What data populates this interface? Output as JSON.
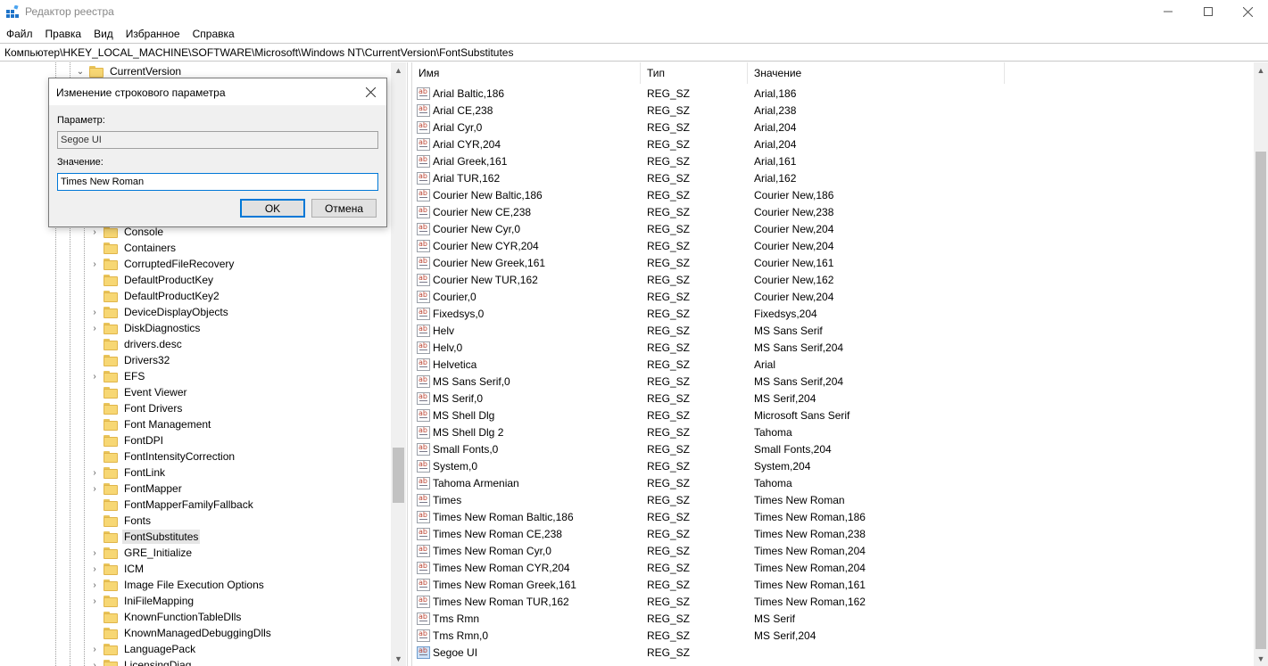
{
  "window": {
    "title": "Редактор реестра",
    "icon": "registry-editor-icon"
  },
  "menu": [
    "Файл",
    "Правка",
    "Вид",
    "Избранное",
    "Справка"
  ],
  "address": "Компьютер\\HKEY_LOCAL_MACHINE\\SOFTWARE\\Microsoft\\Windows NT\\CurrentVersion\\FontSubstitutes",
  "tree": {
    "parent": {
      "label": "CurrentVersion",
      "expanded": true
    },
    "items": [
      {
        "label": "Console",
        "expandable": true
      },
      {
        "label": "Containers",
        "expandable": false
      },
      {
        "label": "CorruptedFileRecovery",
        "expandable": true
      },
      {
        "label": "DefaultProductKey",
        "expandable": false
      },
      {
        "label": "DefaultProductKey2",
        "expandable": false
      },
      {
        "label": "DeviceDisplayObjects",
        "expandable": true
      },
      {
        "label": "DiskDiagnostics",
        "expandable": true
      },
      {
        "label": "drivers.desc",
        "expandable": false
      },
      {
        "label": "Drivers32",
        "expandable": false
      },
      {
        "label": "EFS",
        "expandable": true
      },
      {
        "label": "Event Viewer",
        "expandable": false
      },
      {
        "label": "Font Drivers",
        "expandable": false
      },
      {
        "label": "Font Management",
        "expandable": false
      },
      {
        "label": "FontDPI",
        "expandable": false
      },
      {
        "label": "FontIntensityCorrection",
        "expandable": false
      },
      {
        "label": "FontLink",
        "expandable": true
      },
      {
        "label": "FontMapper",
        "expandable": true
      },
      {
        "label": "FontMapperFamilyFallback",
        "expandable": false
      },
      {
        "label": "Fonts",
        "expandable": false
      },
      {
        "label": "FontSubstitutes",
        "expandable": false,
        "selected": true
      },
      {
        "label": "GRE_Initialize",
        "expandable": true
      },
      {
        "label": "ICM",
        "expandable": true
      },
      {
        "label": "Image File Execution Options",
        "expandable": true
      },
      {
        "label": "IniFileMapping",
        "expandable": true
      },
      {
        "label": "KnownFunctionTableDlls",
        "expandable": false
      },
      {
        "label": "KnownManagedDebuggingDlls",
        "expandable": false
      },
      {
        "label": "LanguagePack",
        "expandable": true
      },
      {
        "label": "LicensingDiag",
        "expandable": true
      }
    ]
  },
  "list": {
    "columns": [
      "Имя",
      "Тип",
      "Значение"
    ],
    "rows": [
      {
        "name": "Arial Baltic,186",
        "type": "REG_SZ",
        "value": "Arial,186"
      },
      {
        "name": "Arial CE,238",
        "type": "REG_SZ",
        "value": "Arial,238"
      },
      {
        "name": "Arial Cyr,0",
        "type": "REG_SZ",
        "value": "Arial,204"
      },
      {
        "name": "Arial CYR,204",
        "type": "REG_SZ",
        "value": "Arial,204"
      },
      {
        "name": "Arial Greek,161",
        "type": "REG_SZ",
        "value": "Arial,161"
      },
      {
        "name": "Arial TUR,162",
        "type": "REG_SZ",
        "value": "Arial,162"
      },
      {
        "name": "Courier New Baltic,186",
        "type": "REG_SZ",
        "value": "Courier New,186"
      },
      {
        "name": "Courier New CE,238",
        "type": "REG_SZ",
        "value": "Courier New,238"
      },
      {
        "name": "Courier New Cyr,0",
        "type": "REG_SZ",
        "value": "Courier New,204"
      },
      {
        "name": "Courier New CYR,204",
        "type": "REG_SZ",
        "value": "Courier New,204"
      },
      {
        "name": "Courier New Greek,161",
        "type": "REG_SZ",
        "value": "Courier New,161"
      },
      {
        "name": "Courier New TUR,162",
        "type": "REG_SZ",
        "value": "Courier New,162"
      },
      {
        "name": "Courier,0",
        "type": "REG_SZ",
        "value": "Courier New,204"
      },
      {
        "name": "Fixedsys,0",
        "type": "REG_SZ",
        "value": "Fixedsys,204"
      },
      {
        "name": "Helv",
        "type": "REG_SZ",
        "value": "MS Sans Serif"
      },
      {
        "name": "Helv,0",
        "type": "REG_SZ",
        "value": "MS Sans Serif,204"
      },
      {
        "name": "Helvetica",
        "type": "REG_SZ",
        "value": "Arial"
      },
      {
        "name": "MS Sans Serif,0",
        "type": "REG_SZ",
        "value": "MS Sans Serif,204"
      },
      {
        "name": "MS Serif,0",
        "type": "REG_SZ",
        "value": "MS Serif,204"
      },
      {
        "name": "MS Shell Dlg",
        "type": "REG_SZ",
        "value": "Microsoft Sans Serif"
      },
      {
        "name": "MS Shell Dlg 2",
        "type": "REG_SZ",
        "value": "Tahoma"
      },
      {
        "name": "Small Fonts,0",
        "type": "REG_SZ",
        "value": "Small Fonts,204"
      },
      {
        "name": "System,0",
        "type": "REG_SZ",
        "value": "System,204"
      },
      {
        "name": "Tahoma Armenian",
        "type": "REG_SZ",
        "value": "Tahoma"
      },
      {
        "name": "Times",
        "type": "REG_SZ",
        "value": "Times New Roman"
      },
      {
        "name": "Times New Roman Baltic,186",
        "type": "REG_SZ",
        "value": "Times New Roman,186"
      },
      {
        "name": "Times New Roman CE,238",
        "type": "REG_SZ",
        "value": "Times New Roman,238"
      },
      {
        "name": "Times New Roman Cyr,0",
        "type": "REG_SZ",
        "value": "Times New Roman,204"
      },
      {
        "name": "Times New Roman CYR,204",
        "type": "REG_SZ",
        "value": "Times New Roman,204"
      },
      {
        "name": "Times New Roman Greek,161",
        "type": "REG_SZ",
        "value": "Times New Roman,161"
      },
      {
        "name": "Times New Roman TUR,162",
        "type": "REG_SZ",
        "value": "Times New Roman,162"
      },
      {
        "name": "Tms Rmn",
        "type": "REG_SZ",
        "value": "MS Serif"
      },
      {
        "name": "Tms Rmn,0",
        "type": "REG_SZ",
        "value": "MS Serif,204"
      },
      {
        "name": "Segoe UI",
        "type": "REG_SZ",
        "value": "",
        "selected": true
      }
    ]
  },
  "dialog": {
    "title": "Изменение строкового параметра",
    "param_label": "Параметр:",
    "param_value": "Segoe UI",
    "value_label": "Значение:",
    "value_value": "Times New Roman",
    "ok_label": "OK",
    "cancel_label": "Отмена"
  },
  "colors": {
    "accent": "#0078d7",
    "folder": "#f7d774",
    "selection": "#e5e5e5"
  }
}
